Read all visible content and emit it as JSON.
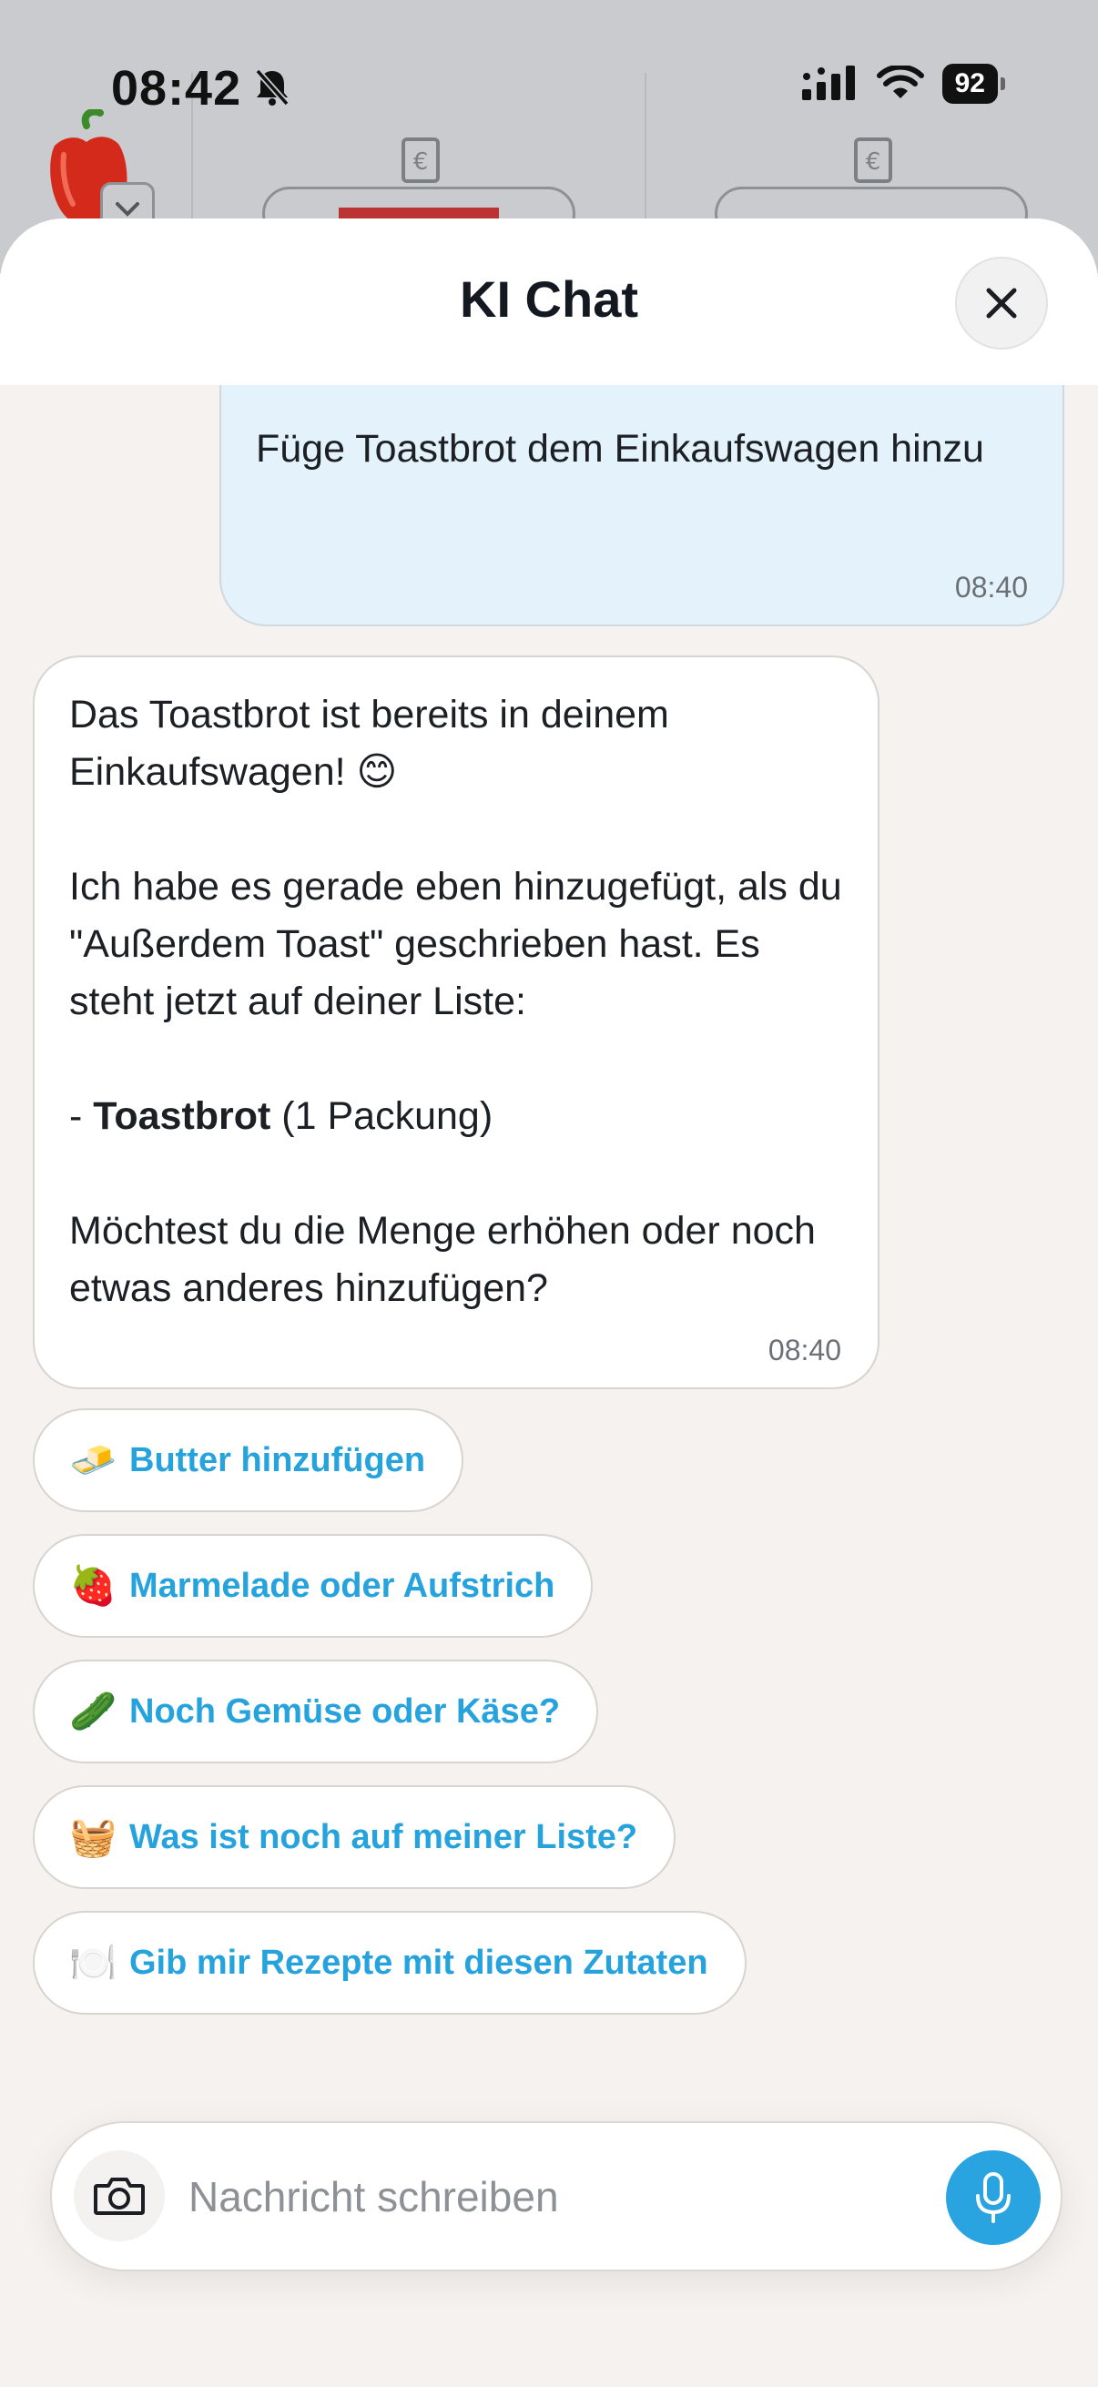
{
  "status": {
    "time": "08:42",
    "battery": "92"
  },
  "sheet": {
    "title": "KI Chat"
  },
  "messages": {
    "user": {
      "text": "Füge Toastbrot dem Einkaufswagen hinzu",
      "time": "08:40"
    },
    "bot": {
      "line1": "Das Toastbrot ist bereits in deinem Einkaufswagen! 😊",
      "line2": "Ich habe es gerade eben hinzugefügt, als du \"Außerdem Toast\" geschrieben hast. Es steht jetzt auf deiner Liste:",
      "list_prefix": "- ",
      "list_item_bold": "Toastbrot",
      "list_item_rest": " (1 Packung)",
      "line3": "Möchtest du die Menge erhöhen oder noch etwas anderes hinzufügen?",
      "time": "08:40"
    }
  },
  "suggestions": [
    {
      "emoji": "🧈",
      "label": "Butter hinzufügen"
    },
    {
      "emoji": "🍓",
      "label": "Marmelade oder Aufstrich"
    },
    {
      "emoji": "🥒",
      "label": "Noch Gemüse oder Käse?"
    },
    {
      "emoji": "🧺",
      "label": "Was ist noch auf meiner Liste?"
    },
    {
      "emoji": "🍽️",
      "label": "Gib mir Rezepte mit diesen Zutaten"
    }
  ],
  "composer": {
    "placeholder": "Nachricht schreiben"
  },
  "colors": {
    "accent": "#2aa4e0",
    "user_bubble": "#e3f2fb",
    "background": "#f5f2ef"
  }
}
